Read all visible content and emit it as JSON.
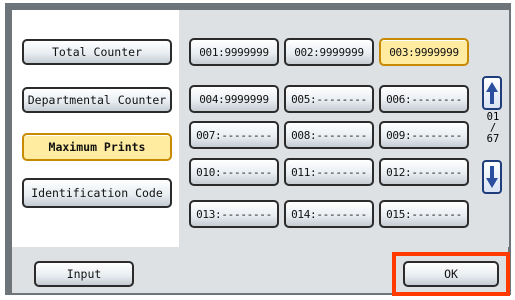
{
  "menu": [
    {
      "label": "Total Counter",
      "name": "total-counter-button",
      "selected": false
    },
    {
      "label": "Departmental Counter",
      "name": "departmental-counter-button",
      "selected": false
    },
    {
      "label": "Maximum Prints",
      "name": "maximum-prints-button",
      "selected": true
    },
    {
      "label": "Identification Code",
      "name": "identification-code-button",
      "selected": false
    }
  ],
  "cells": [
    "001:9999999",
    "002:9999999",
    "003:9999999",
    "004:9999999",
    "005:--------",
    "006:--------",
    "007:--------",
    "008:--------",
    "009:--------",
    "010:--------",
    "011:--------",
    "012:--------",
    "013:--------",
    "014:--------",
    "015:--------"
  ],
  "selected_cell_index": 2,
  "pager": {
    "current": "01",
    "separator": "/",
    "total": "67"
  },
  "buttons": {
    "input_label": "Input",
    "ok_label": "OK"
  },
  "icons": {
    "up": "up-arrow-icon",
    "down": "down-arrow-icon"
  },
  "colors": {
    "selected": "#ffeca0",
    "highlight": "#ff3b00",
    "frame": "#6d757b"
  }
}
